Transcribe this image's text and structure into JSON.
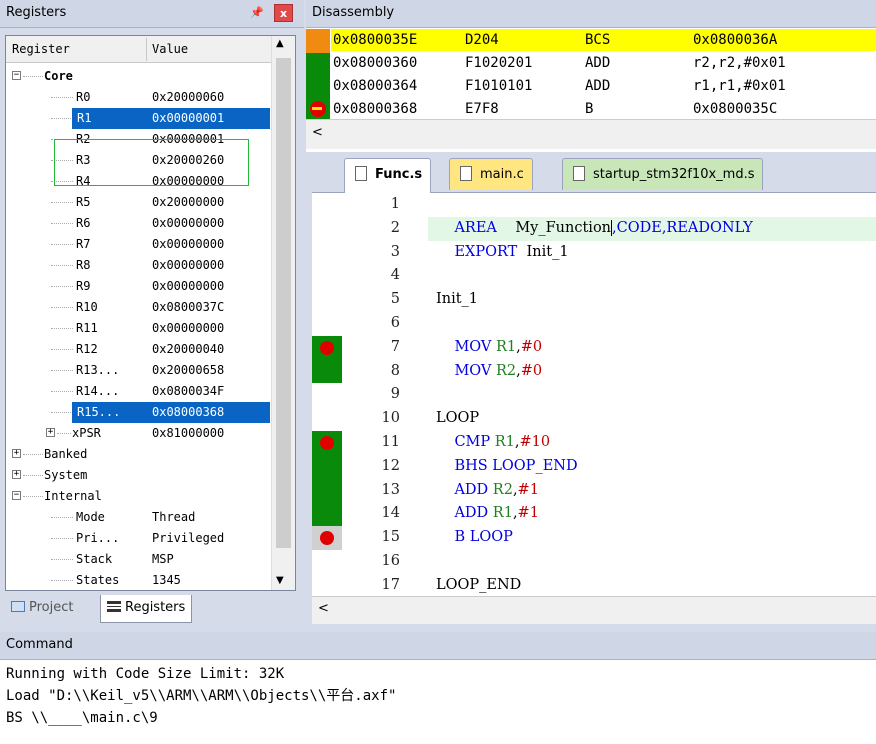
{
  "registers": {
    "title": "Registers",
    "pin_icon": "pin-icon",
    "close_label": "x",
    "columns": [
      "Register",
      "Value"
    ],
    "core_label": "Core",
    "rows": [
      {
        "name": "R0",
        "value": "0x20000060"
      },
      {
        "name": "R1",
        "value": "0x00000001",
        "selected": true
      },
      {
        "name": "R2",
        "value": "0x00000001"
      },
      {
        "name": "R3",
        "value": "0x20000260"
      },
      {
        "name": "R4",
        "value": "0x00000000"
      },
      {
        "name": "R5",
        "value": "0x20000000"
      },
      {
        "name": "R6",
        "value": "0x00000000"
      },
      {
        "name": "R7",
        "value": "0x00000000"
      },
      {
        "name": "R8",
        "value": "0x00000000"
      },
      {
        "name": "R9",
        "value": "0x00000000"
      },
      {
        "name": "R10",
        "value": "0x0800037C"
      },
      {
        "name": "R11",
        "value": "0x00000000"
      },
      {
        "name": "R12",
        "value": "0x20000040"
      },
      {
        "name": "R13...",
        "value": "0x20000658"
      },
      {
        "name": "R14...",
        "value": "0x0800034F"
      },
      {
        "name": "R15...",
        "value": "0x08000368",
        "selected": true
      },
      {
        "name": "xPSR",
        "value": "0x81000000"
      }
    ],
    "groups": [
      "Banked",
      "System",
      "Internal"
    ],
    "internal_rows": [
      {
        "name": "Mode",
        "value": "Thread"
      },
      {
        "name": "Pri...",
        "value": "Privileged"
      },
      {
        "name": "Stack",
        "value": "MSP"
      },
      {
        "name": "States",
        "value": "1345"
      }
    ],
    "tabs": {
      "project": "Project",
      "registers": "Registers"
    }
  },
  "disassembly": {
    "title": "Disassembly",
    "rows": [
      {
        "addr": "0x0800035E",
        "code": "D204",
        "mnem": "BCS",
        "ops": "0x0800036A",
        "current": true
      },
      {
        "addr": "0x08000360",
        "code": "F1020201",
        "mnem": "ADD",
        "ops": "r2,r2,#0x01"
      },
      {
        "addr": "0x08000364",
        "code": "F1010101",
        "mnem": "ADD",
        "ops": "r1,r1,#0x01"
      },
      {
        "addr": "0x08000368",
        "code": "E7F8",
        "mnem": "B",
        "ops": "0x0800035C"
      }
    ],
    "scroll_left": "<"
  },
  "editor": {
    "tabs": [
      "Func.s",
      "main.c",
      "startup_stm32f10x_md.s"
    ],
    "close_glyph": "×",
    "scroll_left": "<",
    "lines": [
      {
        "n": "1"
      },
      {
        "n": "2"
      },
      {
        "n": "3"
      },
      {
        "n": "4"
      },
      {
        "n": "5"
      },
      {
        "n": "6"
      },
      {
        "n": "7"
      },
      {
        "n": "8"
      },
      {
        "n": "9"
      },
      {
        "n": "10"
      },
      {
        "n": "11"
      },
      {
        "n": "12"
      },
      {
        "n": "13"
      },
      {
        "n": "14"
      },
      {
        "n": "15"
      },
      {
        "n": "16"
      },
      {
        "n": "17"
      }
    ],
    "code": {
      "l2_kw": "AREA",
      "l2_name": "My_Function",
      "l2_rest": ",CODE,READONLY",
      "l3_kw": "EXPORT",
      "l3_name": "Init_1",
      "l5": "Init_1",
      "l7_kw": "MOV",
      "l7_reg": "R1",
      "l7_num": "#0",
      "l8_kw": "MOV",
      "l8_reg": "R2",
      "l8_num": "#0",
      "l10": "LOOP",
      "l11_kw": "CMP",
      "l11_reg": "R1",
      "l11_num": "#10",
      "l12": "BHS LOOP_END",
      "l13_kw": "ADD",
      "l13_reg": "R2",
      "l13_num": "#1",
      "l14_kw": "ADD",
      "l14_reg": "R1",
      "l14_num": "#1",
      "l15": "B LOOP",
      "l17": "LOOP_END",
      "comma": ","
    }
  },
  "command": {
    "title": "Command",
    "lines": [
      "Running with Code Size Limit: 32K",
      "Load \"D:\\\\Keil_v5\\\\ARM\\\\ARM\\\\Objects\\\\平台.axf\"",
      "BS \\\\____\\main.c\\9"
    ]
  },
  "colors": {
    "current_line": "#ffff00",
    "breakpoint": "#e00000",
    "coverage_green": "#0a8a0a",
    "selection": "#0a64c4",
    "keyword": "#0000e0",
    "register": "#208020",
    "number": "#c00000"
  }
}
